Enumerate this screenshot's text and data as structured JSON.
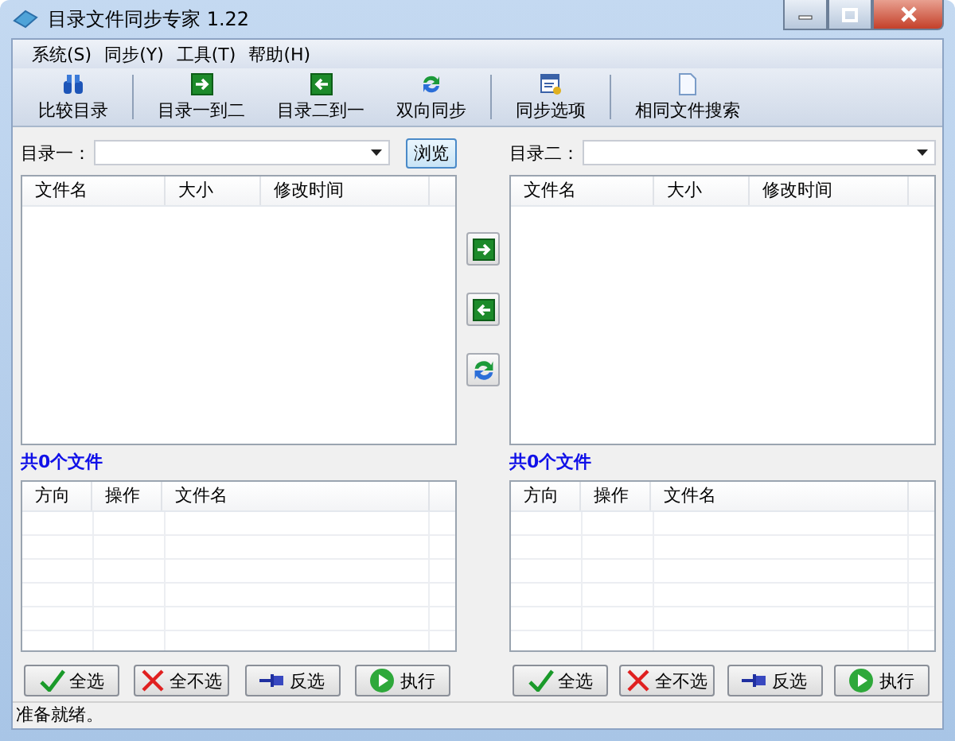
{
  "window": {
    "title": "目录文件同步专家 1.22"
  },
  "menu": [
    {
      "label": "系统(S)"
    },
    {
      "label": "同步(Y)"
    },
    {
      "label": "工具(T)"
    },
    {
      "label": "帮助(H)"
    }
  ],
  "toolbar_groups": [
    {
      "buttons": [
        {
          "label": "比较目录",
          "kind": "compare"
        }
      ]
    },
    {
      "buttons": [
        {
          "label": "目录一到二",
          "kind": "right"
        },
        {
          "label": "目录二到一",
          "kind": "left"
        },
        {
          "label": "双向同步",
          "kind": "sync"
        }
      ]
    },
    {
      "buttons": [
        {
          "label": "同步选项",
          "kind": "options"
        }
      ]
    },
    {
      "buttons": [
        {
          "label": "相同文件搜索",
          "kind": "document"
        }
      ]
    }
  ],
  "panes": [
    {
      "path_label": "目录一：",
      "browse": "浏览",
      "file_columns": [
        "文件名",
        "大小",
        "修改时间"
      ],
      "count": "共0个文件",
      "op_columns": [
        "方向",
        "操作",
        "文件名"
      ],
      "buttons": [
        {
          "label": "全选",
          "kind": "check"
        },
        {
          "label": "全不选",
          "kind": "cross"
        },
        {
          "label": "反选",
          "kind": "pin"
        },
        {
          "label": "执行",
          "kind": "play"
        }
      ]
    },
    {
      "path_label": "目录二：",
      "file_columns": [
        "文件名",
        "大小",
        "修改时间"
      ],
      "count": "共0个文件",
      "op_columns": [
        "方向",
        "操作",
        "文件名"
      ],
      "buttons": [
        {
          "label": "全选",
          "kind": "check"
        },
        {
          "label": "全不选",
          "kind": "cross"
        },
        {
          "label": "反选",
          "kind": "pin"
        },
        {
          "label": "执行",
          "kind": "play"
        }
      ]
    }
  ],
  "transfer_buttons": [
    {
      "kind": "right"
    },
    {
      "kind": "left"
    },
    {
      "kind": "sync"
    }
  ],
  "status_bar": "准备就绪。"
}
